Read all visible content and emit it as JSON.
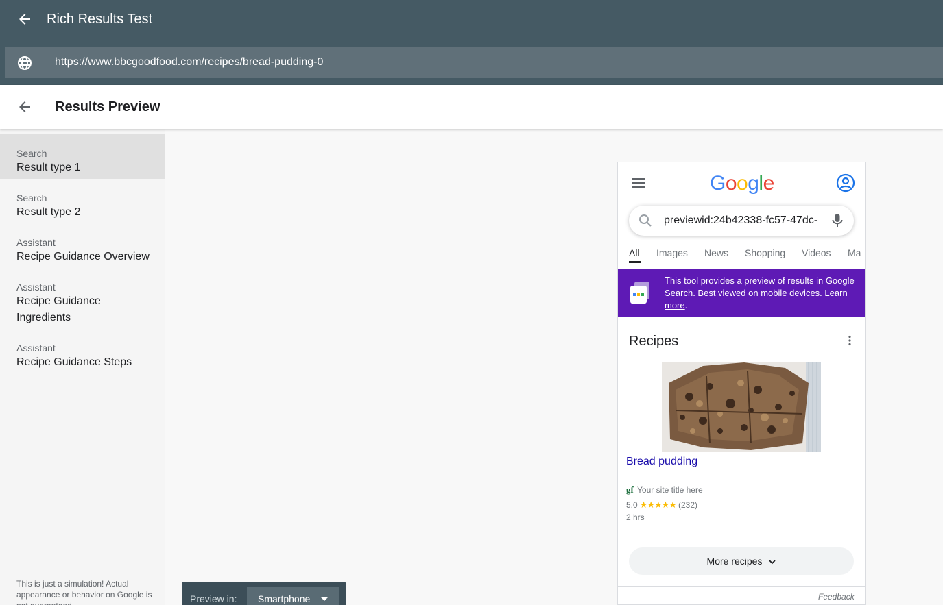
{
  "app": {
    "title": "Rich Results Test",
    "url": "https://www.bbcgoodfood.com/recipes/bread-pudding-0"
  },
  "subheader": {
    "title": "Results Preview"
  },
  "sidebar": {
    "items": [
      {
        "category": "Search",
        "label": "Result type 1",
        "active": true
      },
      {
        "category": "Search",
        "label": "Result type 2",
        "active": false
      },
      {
        "category": "Assistant",
        "label": "Recipe Guidance Overview",
        "active": false
      },
      {
        "category": "Assistant",
        "label": "Recipe Guidance Ingredients",
        "active": false
      },
      {
        "category": "Assistant",
        "label": "Recipe Guidance Steps",
        "active": false
      }
    ],
    "disclaimer_bold": "This is just a simulation!",
    "disclaimer_rest": " Actual appearance or behavior on Google is not guaranteed."
  },
  "phone": {
    "search_query": "previewid:24b42338-fc57-47dc-",
    "tabs": [
      "All",
      "Images",
      "News",
      "Shopping",
      "Videos",
      "Ma"
    ],
    "banner_text": "This tool provides a preview of results in Google Search. Best viewed on mobile devices.",
    "banner_link": "Learn more",
    "banner_period": ".",
    "card_title": "Recipes",
    "recipe": {
      "title": "Bread pudding",
      "favicon": "gf",
      "site": "Your site title here",
      "rating": "5.0",
      "stars": "★★★★★",
      "reviews": "(232)",
      "time": "2 hrs"
    },
    "more_button": "More recipes",
    "feedback": "Feedback"
  },
  "preview_bar": {
    "label": "Preview in:",
    "device": "Smartphone"
  },
  "colors": {
    "header": "#455a64",
    "banner": "#5e1ab5",
    "link": "#1a0dab",
    "star": "#fbbc04"
  }
}
